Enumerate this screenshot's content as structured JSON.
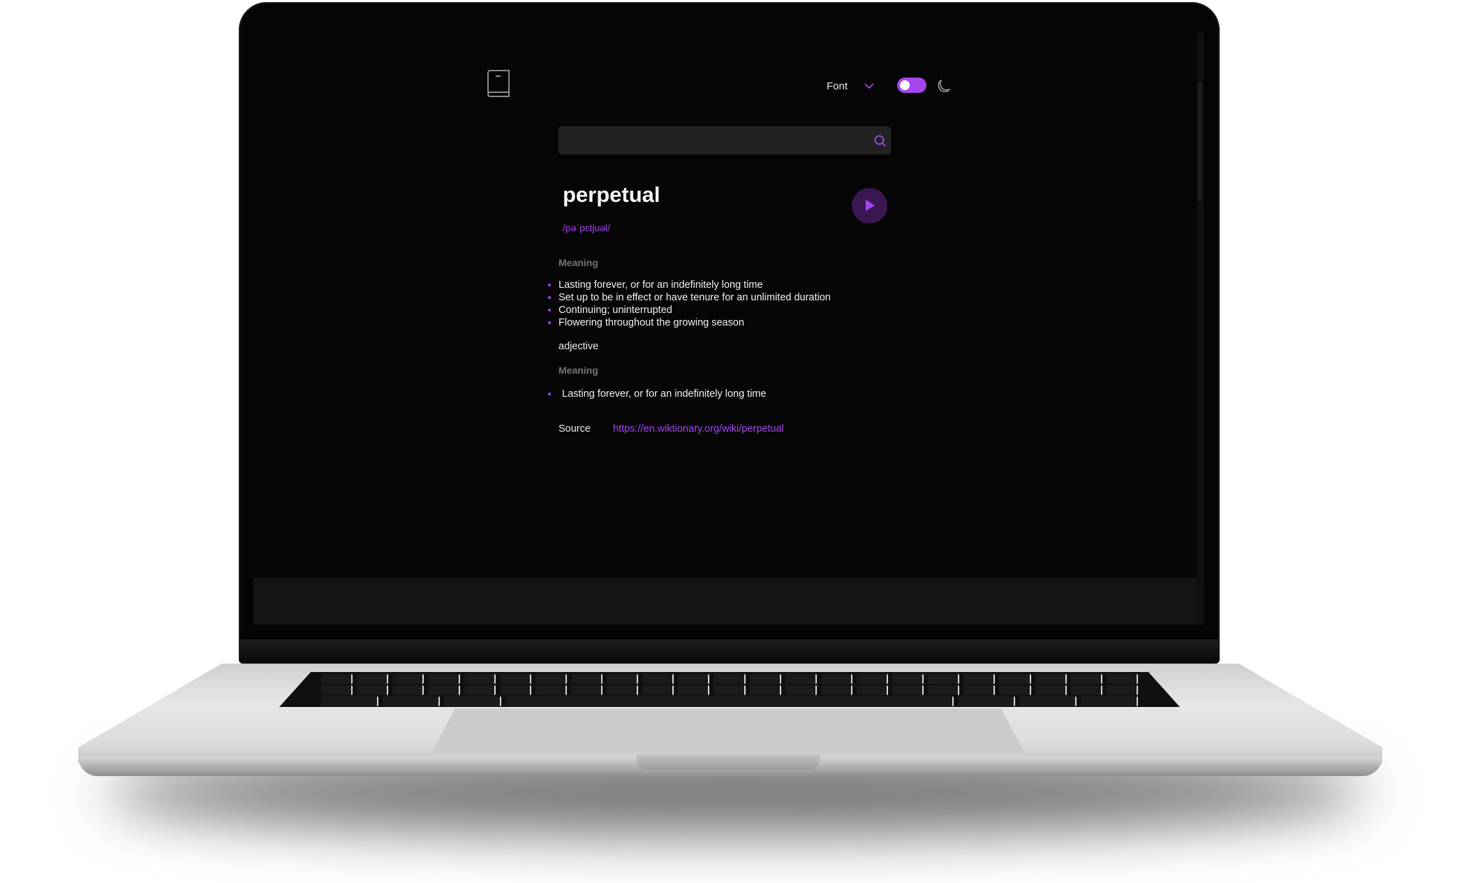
{
  "header": {
    "logo_icon": "book-icon",
    "font_selector": {
      "label": "Font",
      "icon": "chevron-down-icon"
    },
    "theme_toggle": {
      "state": "on",
      "icon": "moon-icon"
    }
  },
  "search": {
    "value": "",
    "placeholder": "",
    "icon": "search-icon"
  },
  "entry": {
    "word": "perpetual",
    "phonetic": "/pəˈpɛtjuəl/",
    "play_icon": "play-icon"
  },
  "meanings": [
    {
      "heading": "Meaning",
      "definitions": [
        "Lasting forever, or for an indefinitely long time",
        "Set up to be in effect or have tenure for an unlimited duration",
        "Continuing; uninterrupted",
        "Flowering throughout the growing season"
      ]
    },
    {
      "part_of_speech": "adjective",
      "heading": "Meaning",
      "definitions": [
        "Lasting forever, or for an indefinitely long time"
      ]
    }
  ],
  "source": {
    "label": "Source",
    "url": "https://en.wiktionary.org/wiki/perpetual"
  },
  "colors": {
    "accent": "#a445ed",
    "background": "#060606",
    "search_bg": "#222222",
    "text": "#f2f2f2",
    "muted": "#757575",
    "play_bg": "#3b1752"
  }
}
